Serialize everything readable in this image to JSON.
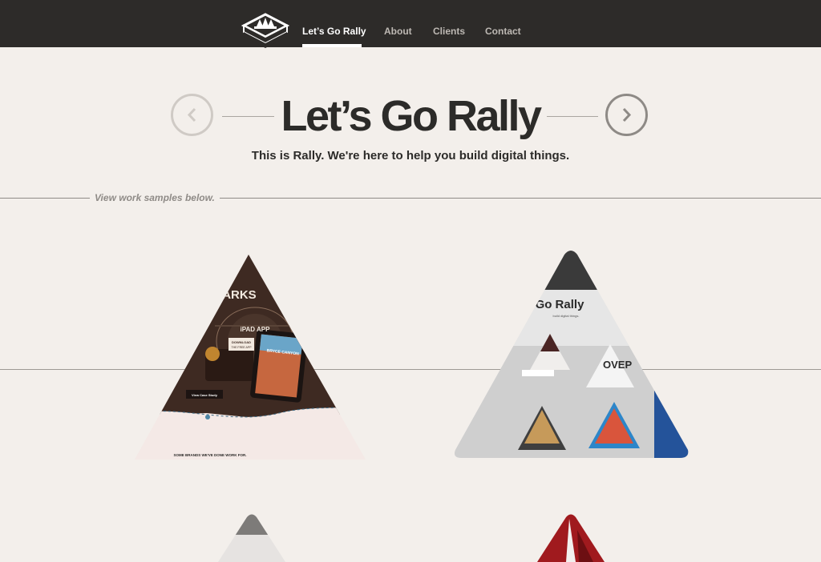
{
  "nav": {
    "logo_icon": "rally-badge-icon",
    "items": [
      {
        "label": "Let’s Go Rally",
        "active": true
      },
      {
        "label": "About",
        "active": false
      },
      {
        "label": "Clients",
        "active": false
      },
      {
        "label": "Contact",
        "active": false
      }
    ]
  },
  "hero": {
    "title": "Let’s Go Rally",
    "tagline": "This is Rally. We're here to help you build digital things.",
    "prev_icon": "chevron-left-icon",
    "next_icon": "chevron-right-icon"
  },
  "work": {
    "label": "View work samples below.",
    "samples": [
      {
        "name": "parks-ipad-app",
        "texts": {
          "parks": "PARKS",
          "ipad_app": "iPAD APP",
          "download": "DOWNLOAD",
          "free_app": "THE FREE APP",
          "bryce": "BRYCE CANYON",
          "view_case": "View Case Study",
          "brands": "SOME BRANDS WE'VE DONE WORK FOR."
        }
      },
      {
        "name": "go-rally-site",
        "texts": {
          "title": "Go Rally",
          "sub": "build digital things.",
          "ovep": "OVEP"
        }
      }
    ]
  },
  "colors": {
    "topbar": "#2d2b29",
    "background": "#f3efeb",
    "text": "#2c2b29",
    "muted": "#8f8b87"
  }
}
